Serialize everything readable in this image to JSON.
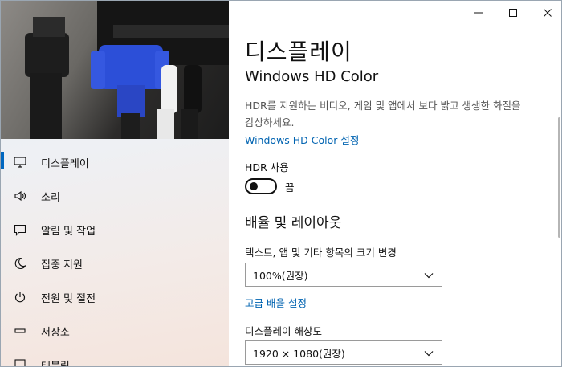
{
  "nav": {
    "items": [
      {
        "label": "디스플레이",
        "icon": "monitor-icon",
        "active": true
      },
      {
        "label": "소리",
        "icon": "speaker-icon",
        "active": false
      },
      {
        "label": "알림 및 작업",
        "icon": "notification-icon",
        "active": false
      },
      {
        "label": "집중 지원",
        "icon": "moon-icon",
        "active": false
      },
      {
        "label": "전원 및 절전",
        "icon": "power-icon",
        "active": false
      },
      {
        "label": "저장소",
        "icon": "storage-icon",
        "active": false
      },
      {
        "label": "태블릿",
        "icon": "tablet-icon",
        "active": false
      }
    ]
  },
  "main": {
    "title": "디스플레이",
    "section_title": "Windows HD Color",
    "description": "HDR를 지원하는 비디오, 게임 및 앱에서 보다 밝고 생생한 화질을 감상하세요.",
    "hd_color_link": "Windows HD Color 설정",
    "hdr_label": "HDR 사용",
    "hdr_state": "끔",
    "layout_heading": "배율 및 레이아웃",
    "scale_label": "텍스트, 앱 및 기타 항목의 크기 변경",
    "scale_value": "100%(권장)",
    "advanced_scale_link": "고급 배율 설정",
    "resolution_label": "디스플레이 해상도",
    "resolution_value": "1920 × 1080(권장)"
  },
  "colors": {
    "accent": "#0067c0",
    "link": "#0063b1",
    "cable_blue": "#2c4fd8"
  }
}
